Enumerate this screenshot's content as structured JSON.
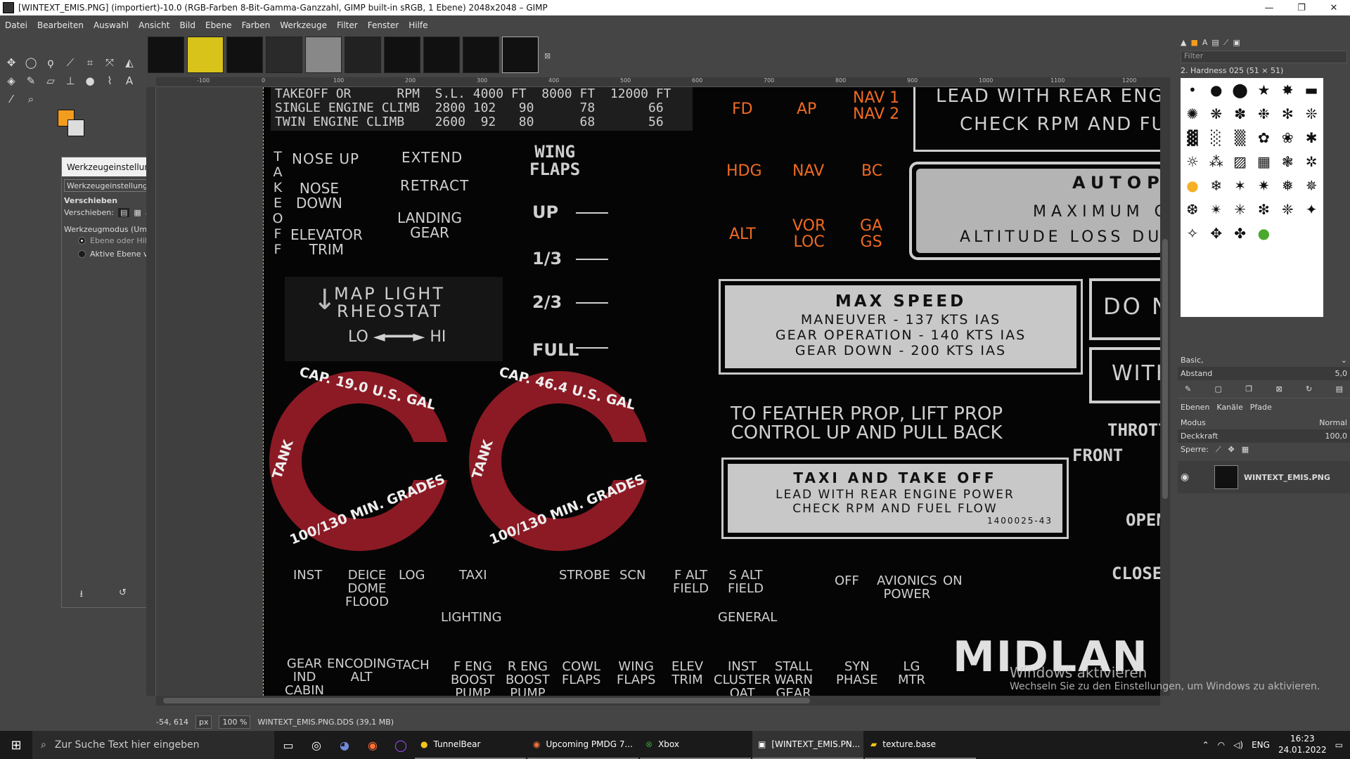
{
  "window": {
    "title": "[WINTEXT_EMIS.PNG] (importiert)-10.0 (RGB-Farben 8-Bit-Gamma-Ganzzahl, GIMP built-in sRGB, 1 Ebene) 2048x2048 – GIMP",
    "minimize": "—",
    "maximize": "❐",
    "close": "✕"
  },
  "menu": [
    "Datei",
    "Bearbeiten",
    "Auswahl",
    "Ansicht",
    "Bild",
    "Ebene",
    "Farben",
    "Werkzeuge",
    "Filter",
    "Fenster",
    "Hilfe"
  ],
  "tool_options": {
    "dialog_title": "Werkzeugeinstellungen",
    "tab_label": "Werkzeugeinstellungen",
    "tool_name": "Verschieben",
    "move_label": "Verschieben:",
    "mode_label": "Werkzeugmodus (Umschalt)",
    "option1": "Ebene oder Hilfslinie auswählen",
    "option2": "Aktive Ebene verschieben",
    "selected_option": 1
  },
  "status": {
    "coords": "-54, 614",
    "unit": "px",
    "zoom": "100 %",
    "file": "WINTEXT_EMIS.PNG.DDS (39,1 MB)"
  },
  "ruler_ticks": [
    "-100",
    "0",
    "100",
    "200",
    "300",
    "400",
    "500",
    "600",
    "700",
    "800",
    "900",
    "1000",
    "1100",
    "1200"
  ],
  "texture": {
    "table_rows": [
      "TAKEOFF OR      RPM  S.L. 4000 FT  8000 FT  12000 FT",
      "SINGLE ENGINE CLIMB  2800 102   90      78       66",
      "TWIN ENGINE CLIMB    2600  92   80      68       56"
    ],
    "takeoff_vertical": "TAKE OFF",
    "nose_up": "NOSE UP",
    "nose_down": "NOSE\nDOWN",
    "elevator_trim": "ELEVATOR\nTRIM",
    "extend": "EXTEND",
    "retract": "RETRACT",
    "landing_gear": "LANDING\nGEAR",
    "wing_flaps": "WING\nFLAPS",
    "flaps": [
      "UP",
      "1/3",
      "2/3",
      "FULL"
    ],
    "map_light": "MAP LIGHT\nRHEOSTAT",
    "lo_hi": "LO ◄━━━► HI",
    "ap_buttons": [
      "FD",
      "AP",
      "NAV 1\nNAV 2",
      "HDG",
      "NAV",
      "BC",
      "ALT",
      "VOR\nLOC",
      "GA\nGS"
    ],
    "tank1": "CAP. 19.0 U.S. GAL",
    "tank2": "CAP. 46.4 U.S. GAL",
    "tank_side": "TANK",
    "tank_bottom": "100/130 MIN. GRADES",
    "max_speed_title": "MAX SPEED",
    "max_speed_lines": [
      "MANEUVER - 137 KTS IAS",
      "GEAR OPERATION  - 140 KTS IAS",
      "GEAR DOWN - 200 KTS IAS"
    ],
    "feather": "TO FEATHER PROP, LIFT PROP\nCONTROL UP AND PULL BACK",
    "taxi_title": "TAXI AND TAKE OFF",
    "taxi_lines": [
      "LEAD WITH REAR ENGINE POWER",
      "CHECK RPM AND FUEL FLOW"
    ],
    "taxi_code": "1400025-43",
    "lead_rear": "LEAD WITH REAR ENGI",
    "check_rpm": "CHECK RPM AND FU",
    "autopilot": "AUTOP",
    "maximum": "MAXIMUM C",
    "alt_loss": "ALTITUDE LOSS DU",
    "do_n": "DO N",
    "with": "WITH",
    "thrott": "THROTT",
    "front": "FRONT",
    "open": "OPEN",
    "close": "CLOSE",
    "lighting_labels": [
      "INST",
      "DEICE\nDOME\nFLOOD",
      "LOG",
      "TAXI",
      "STROBE",
      "SCN",
      "F ALT\nFIELD",
      "S ALT\nFIELD",
      "OFF",
      "AVIONICS\nPOWER",
      "ON"
    ],
    "lighting": "LIGHTING",
    "general": "GENERAL",
    "bottom_labels": [
      "GEAR\nIND\nCABIN",
      "ENCODING\nALT",
      "TACH",
      "F ENG\nBOOST\nPUMP",
      "R ENG\nBOOST\nPUMP",
      "COWL\nFLAPS",
      "WING\nFLAPS",
      "ELEV\nTRIM",
      "INST\nCLUSTER\nOAT",
      "STALL\nWARN\nGEAR",
      "SYN\nPHASE",
      "LG\nMTR"
    ],
    "midland": "MIDLAN"
  },
  "right_panel": {
    "filter_placeholder": "Filter",
    "brush_name": "2. Hardness 025 (51 × 51)",
    "preset": "Basic,",
    "spacing_label": "Abstand",
    "spacing_value": "5,0",
    "tabs": [
      "Ebenen",
      "Kanäle",
      "Pfade"
    ],
    "mode_label": "Modus",
    "mode_value": "Normal",
    "opacity_label": "Deckkraft",
    "opacity_value": "100,0",
    "lock_label": "Sperre:",
    "layer_name": "WINTEXT_EMIS.PNG"
  },
  "watermark": {
    "line1": "Windows aktivieren",
    "line2": "Wechseln Sie zu den Einstellungen, um Windows zu aktivieren."
  },
  "taskbar": {
    "search": "Zur Suche Text hier eingeben",
    "apps": [
      "TunnelBear",
      "Upcoming PMDG 7...",
      "Xbox",
      "[WINTEXT_EMIS.PN...",
      "texture.base"
    ],
    "lang": "ENG",
    "time": "16:23",
    "date": "24.01.2022"
  },
  "colors": {
    "fg": "#f39c1d",
    "bg": "#dddddd",
    "accent_orange": "#f06a22",
    "tank_red": "#8b1a24"
  }
}
